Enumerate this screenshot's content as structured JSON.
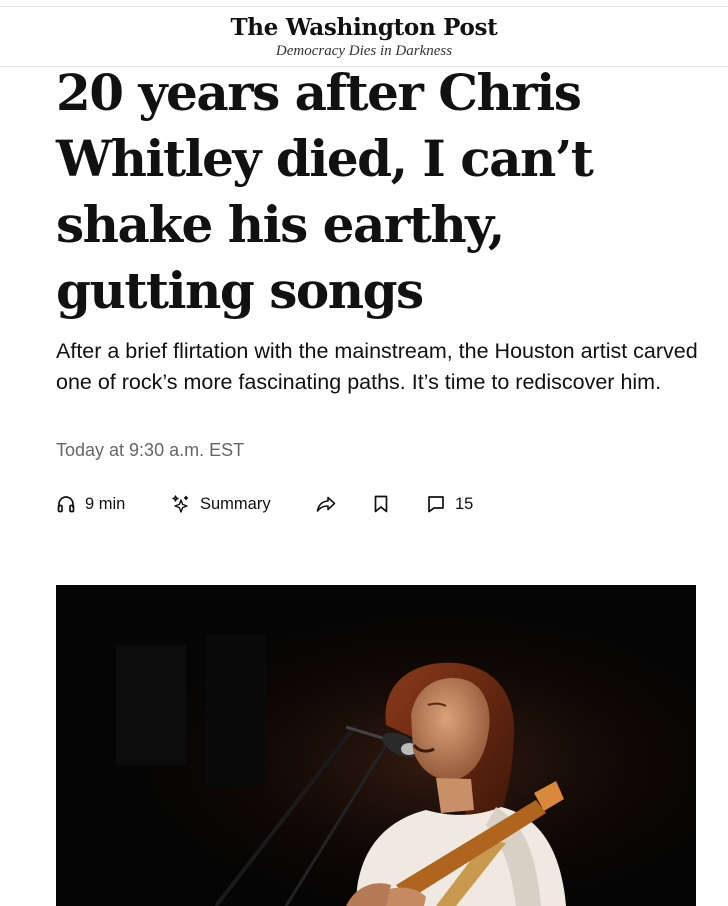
{
  "masthead": {
    "logo_text": "The Washington Post",
    "tagline": "Democracy Dies in Darkness"
  },
  "article": {
    "headline": "20 years after Chris Whitley died, I can’t shake his earthy, gutting songs",
    "dek": "After a brief flirtation with the mainstream, the Houston artist carved one of rock’s more fascinating paths. It’s time to rediscover him.",
    "timestamp": "Today at 9:30 a.m. EST"
  },
  "actions": {
    "listen": {
      "icon": "headphones-icon",
      "label": "9 min"
    },
    "summary": {
      "icon": "sparkle-icon",
      "label": "Summary"
    },
    "share": {
      "icon": "share-icon"
    },
    "save": {
      "icon": "bookmark-icon"
    },
    "comments": {
      "icon": "comment-icon",
      "count": "15"
    }
  },
  "lead_image": {
    "description_colors": {
      "background": "#050505",
      "stage_light": "#c8864e",
      "shirt": "#efe9e2"
    }
  }
}
